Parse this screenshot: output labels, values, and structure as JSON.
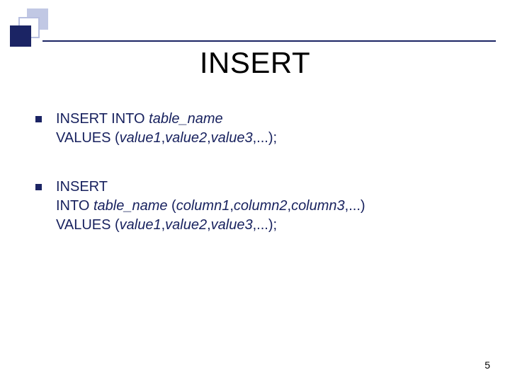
{
  "title": "INSERT",
  "bullets": [
    {
      "line1_before_italic": "INSERT INTO ",
      "line1_italic": "table_name",
      "line1_after_italic": "",
      "line2_before": "VALUES (",
      "line2_italic1": "value1",
      "c1": ",",
      "line2_italic2": "value2",
      "c2": ",",
      "line2_italic3": "value3",
      "line2_after": ",...);",
      "line3_before": "",
      "line3_italic1": "",
      "c3": "",
      "line3_italic2": "",
      "c4": "",
      "line3_italic3": "",
      "line3_after": ""
    },
    {
      "line1_before_italic": "INSERT",
      "line1_italic": "",
      "line1_after_italic": "",
      "line2_before": "INTO ",
      "line2_italic1": "table_name",
      "c1": " (",
      "line2_italic2": "column1",
      "c2": ",",
      "line2_italic3": "column2",
      "line2_after": ",",
      "line2_italic4": "column3",
      "line2_after2": ",...)",
      "line3_before": "VALUES (",
      "line3_italic1": "value1",
      "c3": ",",
      "line3_italic2": "value2",
      "c4": ",",
      "line3_italic3": "value3",
      "line3_after": ",...);"
    }
  ],
  "page_number": "5"
}
